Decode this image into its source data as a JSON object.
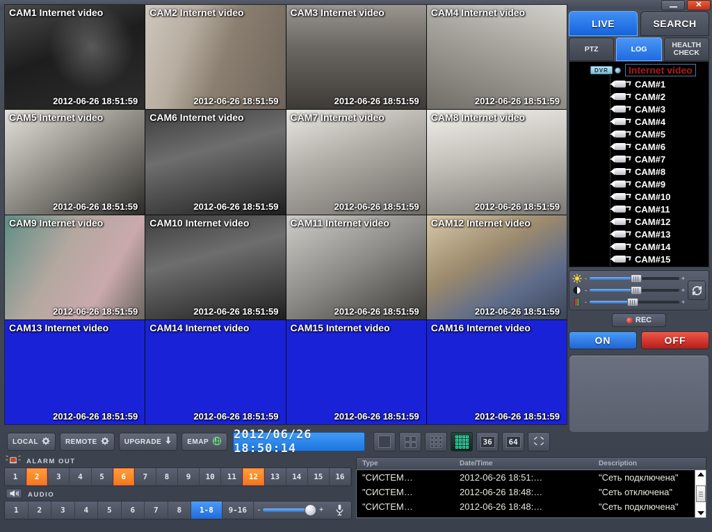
{
  "titlebar": {
    "minimize": "–",
    "close": "✕"
  },
  "tabs": {
    "main": [
      {
        "label": "LIVE",
        "active": true
      },
      {
        "label": "SEARCH",
        "active": false
      }
    ],
    "sub": [
      {
        "label": "PTZ",
        "active": false
      },
      {
        "label": "LOG",
        "active": true
      },
      {
        "label": "HEALTH CHECK",
        "active": false
      }
    ]
  },
  "tree": {
    "dvr_badge": "DVR",
    "dvr_title": "Internet video",
    "cameras": [
      "CAM#1",
      "CAM#2",
      "CAM#3",
      "CAM#4",
      "CAM#5",
      "CAM#6",
      "CAM#7",
      "CAM#8",
      "CAM#9",
      "CAM#10",
      "CAM#11",
      "CAM#12",
      "CAM#13",
      "CAM#14",
      "CAM#15",
      "CAM#16"
    ]
  },
  "adjust": {
    "sliders": [
      {
        "name": "brightness",
        "icon": "sun-icon",
        "value": 52,
        "minus": "-",
        "plus": "+"
      },
      {
        "name": "contrast",
        "icon": "contrast-icon",
        "value": 52,
        "minus": "-",
        "plus": "+"
      },
      {
        "name": "color",
        "icon": "color-icon",
        "value": 48,
        "minus": "-",
        "plus": "+"
      }
    ],
    "reset_label": "reset-icon"
  },
  "record": {
    "rec_label": "REC",
    "on_label": "ON",
    "off_label": "OFF"
  },
  "toolbar": {
    "buttons": [
      {
        "label": "LOCAL",
        "icon": "gear-icon"
      },
      {
        "label": "REMOTE",
        "icon": "gear-icon"
      },
      {
        "label": "UPGRADE",
        "icon": "download-icon"
      },
      {
        "label": "EMAP",
        "icon": "globe-icon"
      }
    ],
    "clock": "2012/06/26 18:50:14",
    "layouts": [
      {
        "label": "1",
        "type": "grid",
        "cols": 1,
        "active": false
      },
      {
        "label": "4",
        "type": "grid",
        "cols": 2,
        "active": false
      },
      {
        "label": "9",
        "type": "grid",
        "cols": 3,
        "active": false
      },
      {
        "label": "16",
        "type": "grid",
        "cols": 4,
        "active": true
      },
      {
        "label": "36",
        "type": "text",
        "active": false
      },
      {
        "label": "64",
        "type": "text",
        "active": false
      },
      {
        "label": "",
        "type": "fullscreen",
        "active": false
      }
    ]
  },
  "alarm_out": {
    "title": "ALARM OUT",
    "icon": "alarm-lamp-icon",
    "channels": [
      {
        "label": "1",
        "active": false
      },
      {
        "label": "2",
        "active": true
      },
      {
        "label": "3",
        "active": false
      },
      {
        "label": "4",
        "active": false
      },
      {
        "label": "5",
        "active": false
      },
      {
        "label": "6",
        "active": true
      },
      {
        "label": "7",
        "active": false
      },
      {
        "label": "8",
        "active": false
      },
      {
        "label": "9",
        "active": false
      },
      {
        "label": "10",
        "active": false
      },
      {
        "label": "11",
        "active": false
      },
      {
        "label": "12",
        "active": true
      },
      {
        "label": "13",
        "active": false
      },
      {
        "label": "14",
        "active": false
      },
      {
        "label": "15",
        "active": false
      },
      {
        "label": "16",
        "active": false
      }
    ]
  },
  "audio": {
    "title": "AUDIO",
    "icon": "speaker-icon",
    "channels": [
      {
        "label": "1",
        "active": false
      },
      {
        "label": "2",
        "active": false
      },
      {
        "label": "3",
        "active": false
      },
      {
        "label": "4",
        "active": false
      },
      {
        "label": "5",
        "active": false
      },
      {
        "label": "6",
        "active": false
      },
      {
        "label": "7",
        "active": false
      },
      {
        "label": "8",
        "active": false
      }
    ],
    "bank_low": {
      "label": "1-8",
      "active": true
    },
    "bank_high": {
      "label": "9-16",
      "active": false
    },
    "volume": 92,
    "minus": "-",
    "plus": "+",
    "mic_icon": "microphone-icon"
  },
  "log": {
    "columns": [
      "Type",
      "Date/Time",
      "Description"
    ],
    "rows": [
      {
        "type": "\"СИСТЕМ…",
        "datetime": "2012-06-26 18:51:…",
        "description": "\"Сеть подключена\""
      },
      {
        "type": "\"СИСТЕМ…",
        "datetime": "2012-06-26 18:48:…",
        "description": "\"Сеть отключена\""
      },
      {
        "type": "\"СИСТЕМ…",
        "datetime": "2012-06-26 18:48:…",
        "description": "\"Сеть подключена\""
      }
    ]
  },
  "video_grid": {
    "rows": 4,
    "cols": 4,
    "cells": [
      {
        "label": "CAM1  Internet video",
        "timestamp": "2012-06-26 18:51:59",
        "scene": "s-dark",
        "signal": true
      },
      {
        "label": "CAM2  Internet video",
        "timestamp": "2012-06-26 18:51:59",
        "scene": "s-hall",
        "signal": true
      },
      {
        "label": "CAM3  Internet video",
        "timestamp": "2012-06-26 18:51:59",
        "scene": "s-store",
        "signal": true
      },
      {
        "label": "CAM4  Internet video",
        "timestamp": "2012-06-26 18:51:59",
        "scene": "s-ware",
        "signal": true
      },
      {
        "label": "CAM5  Internet video",
        "timestamp": "2012-06-26 18:51:59",
        "scene": "s-stair",
        "signal": true
      },
      {
        "label": "CAM6  Internet video",
        "timestamp": "2012-06-26 18:51:59",
        "scene": "s-dim",
        "signal": true
      },
      {
        "label": "CAM7  Internet video",
        "timestamp": "2012-06-26 18:51:59",
        "scene": "s-corr",
        "signal": true
      },
      {
        "label": "CAM8  Internet video",
        "timestamp": "2012-06-26 18:51:59",
        "scene": "s-room",
        "signal": true
      },
      {
        "label": "CAM9  Internet video",
        "timestamp": "2012-06-26 18:51:59",
        "scene": "s-teal",
        "signal": true
      },
      {
        "label": "CAM10  Internet video",
        "timestamp": "2012-06-26 18:51:59",
        "scene": "s-dim",
        "signal": true
      },
      {
        "label": "CAM11  Internet video",
        "timestamp": "2012-06-26 18:51:59",
        "scene": "s-gray",
        "signal": true
      },
      {
        "label": "CAM12  Internet video",
        "timestamp": "2012-06-26 18:51:59",
        "scene": "s-office",
        "signal": true
      },
      {
        "label": "CAM13  Internet video",
        "timestamp": "2012-06-26 18:51:59",
        "scene": "nosignal",
        "signal": false
      },
      {
        "label": "CAM14  Internet video",
        "timestamp": "2012-06-26 18:51:59",
        "scene": "nosignal",
        "signal": false
      },
      {
        "label": "CAM15  Internet video",
        "timestamp": "2012-06-26 18:51:59",
        "scene": "nosignal",
        "signal": false
      },
      {
        "label": "CAM16  Internet video",
        "timestamp": "2012-06-26 18:51:59",
        "scene": "nosignal",
        "signal": false
      }
    ]
  },
  "colors": {
    "accent_blue": "#2f7ae6",
    "alarm_orange": "#f2761b",
    "off_red": "#c2231c",
    "nosignal_blue": "#1a22d8",
    "panel_gray": "#4a505c"
  }
}
